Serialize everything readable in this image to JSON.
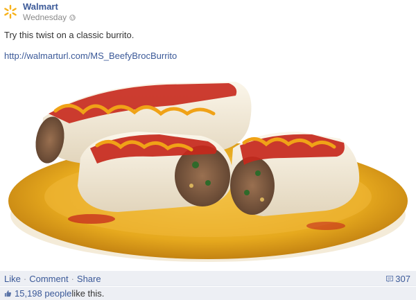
{
  "post": {
    "author": "Walmart",
    "timestamp": "Wednesday",
    "message": "Try this twist on a classic burrito.",
    "link_text": "http://walmarturl.com/MS_BeefyBrocBurrito",
    "icons": {
      "logo": "walmart-spark-icon",
      "privacy": "globe-icon",
      "comment": "comment-icon",
      "like": "thumbs-up-icon"
    },
    "colors": {
      "link_blue": "#3b5998",
      "logo_yellow": "#f7b21b",
      "bar_bg": "#edeff4",
      "meta_gray": "#8a8a8a"
    }
  },
  "actions": {
    "like": "Like",
    "comment": "Comment",
    "share": "Share",
    "separator": "·",
    "comment_count": "307"
  },
  "likes": {
    "link_text": "15,198 people",
    "suffix": " like this."
  }
}
